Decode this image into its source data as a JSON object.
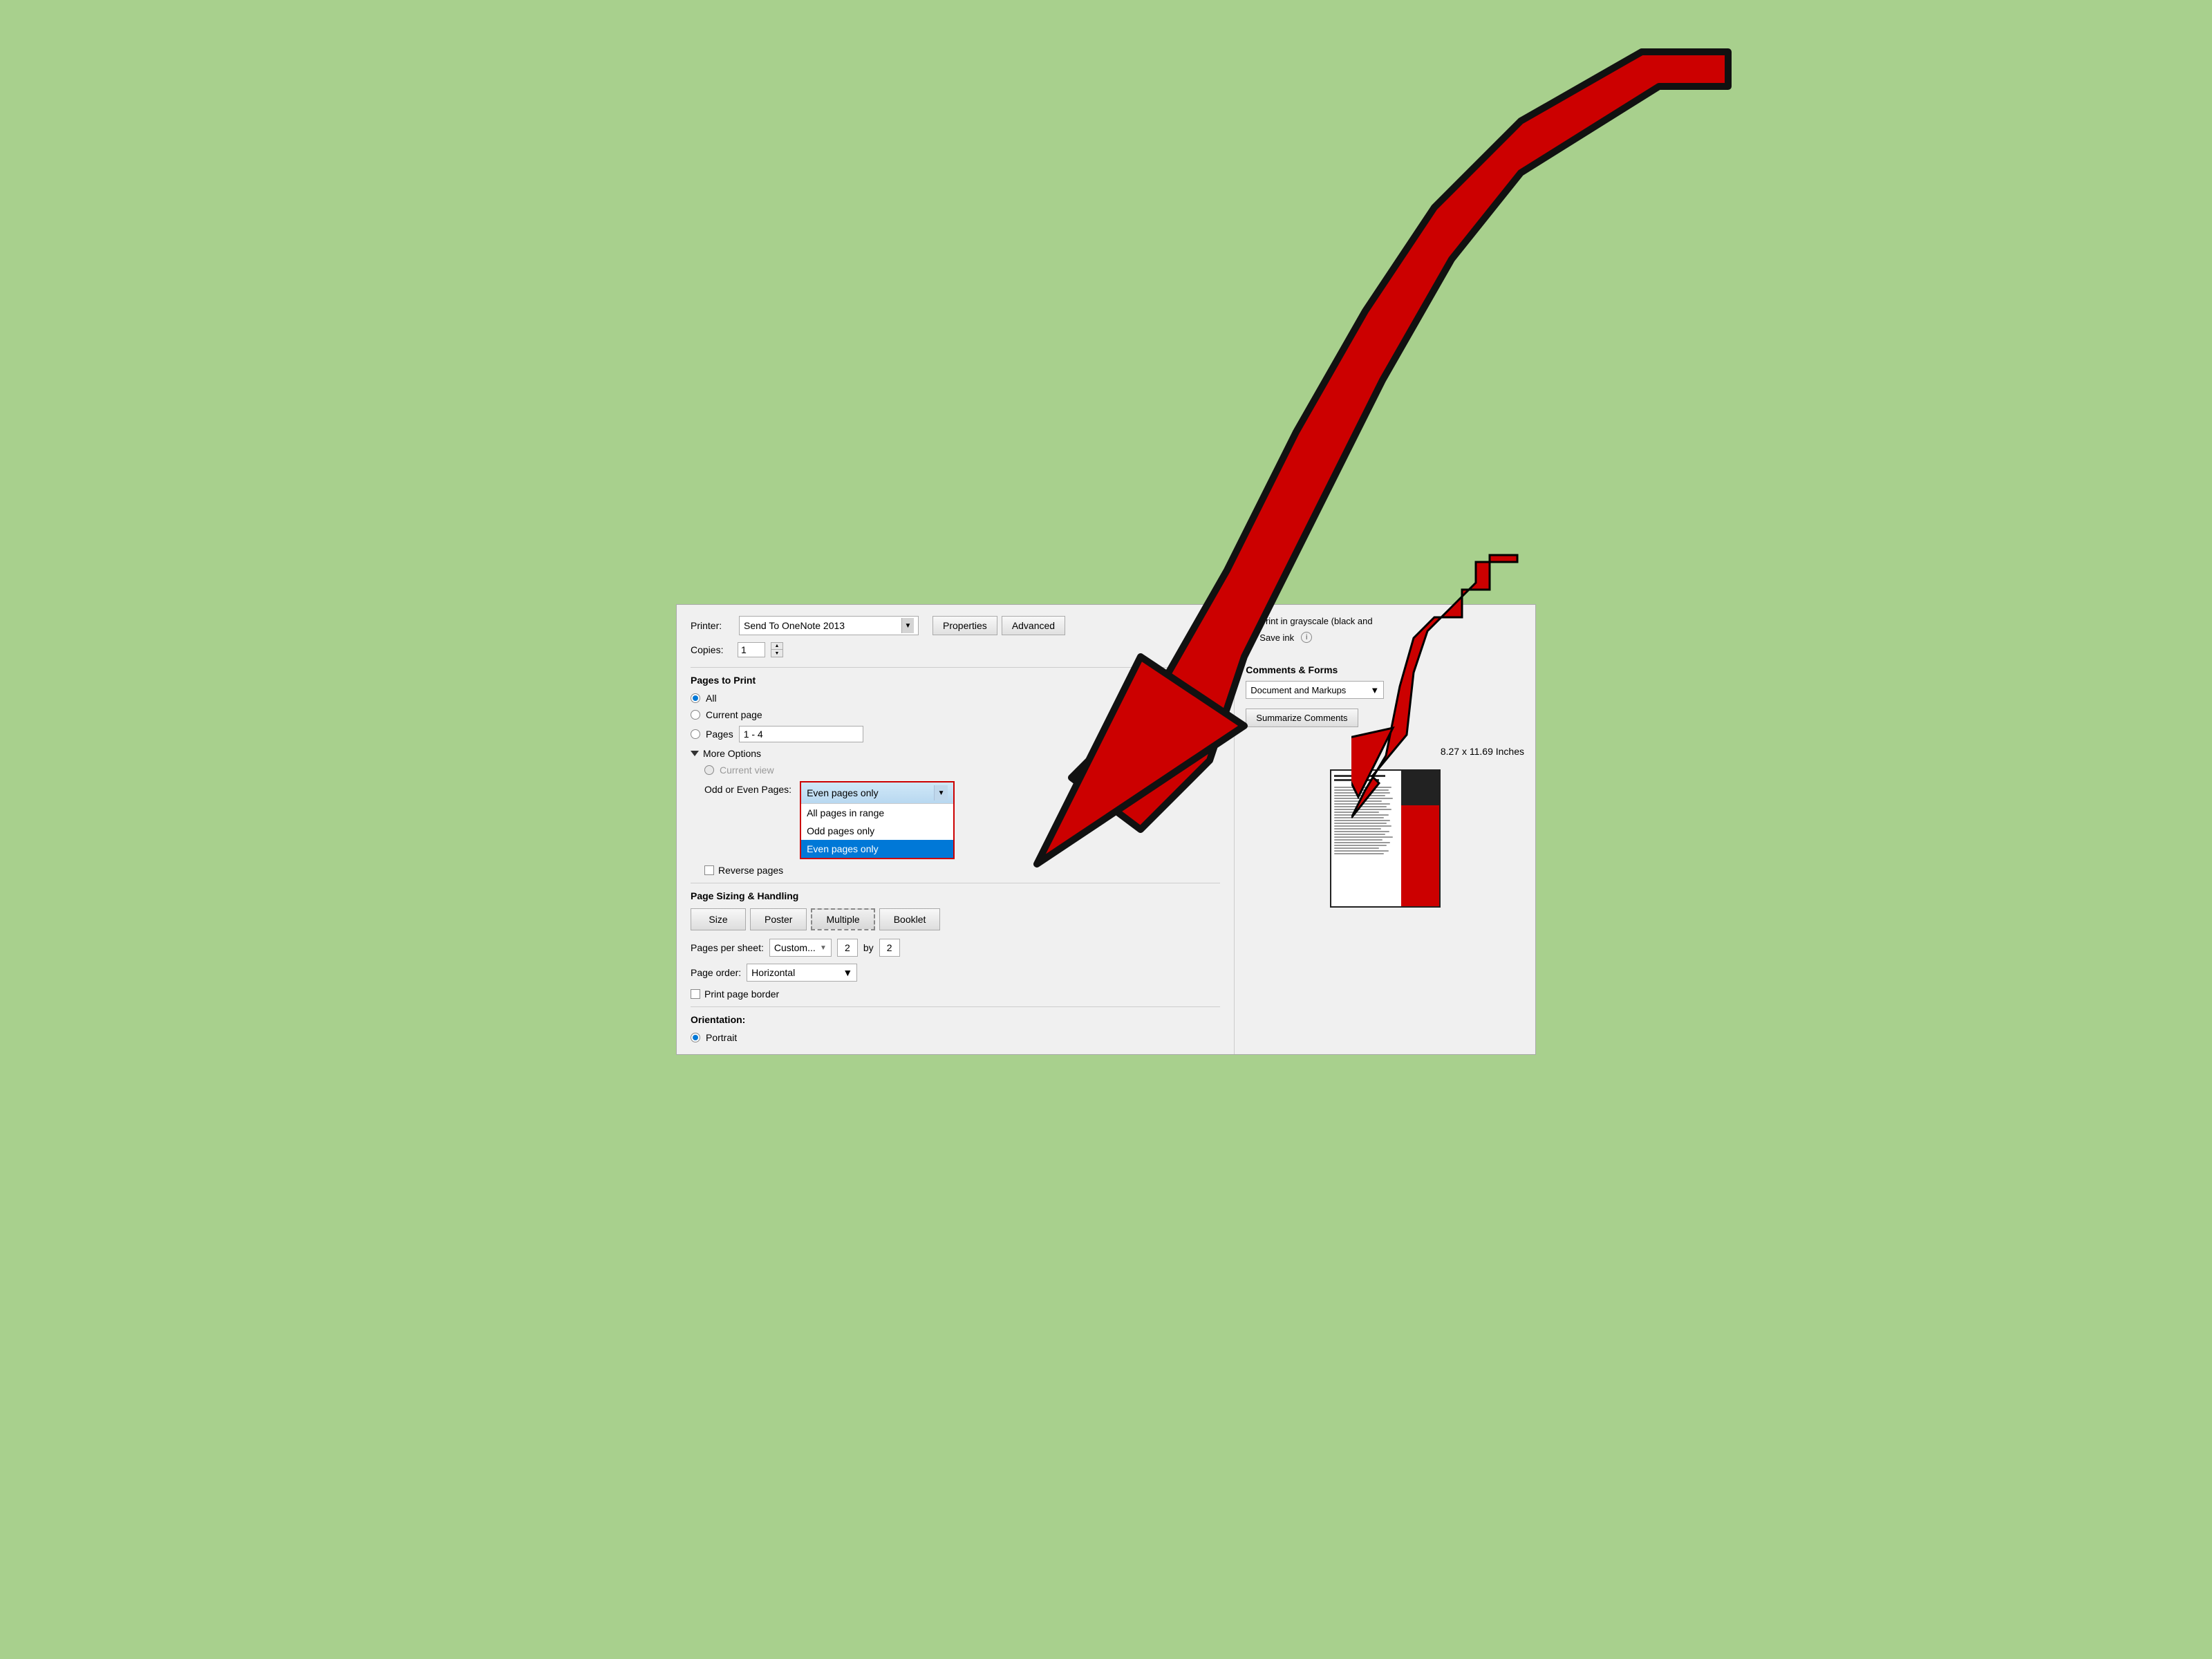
{
  "header": {
    "printer_label": "Printer:",
    "printer_value": "Send To OneNote 2013",
    "properties_btn": "Properties",
    "advanced_btn": "Advanced",
    "copies_label": "Copies:",
    "copies_value": "1"
  },
  "right_checkboxes": {
    "print_grayscale": "Print in grayscale (black and",
    "save_ink": "Save ink"
  },
  "pages_to_print": {
    "title": "Pages to Print",
    "all_label": "All",
    "current_page_label": "Current page",
    "pages_label": "Pages",
    "pages_value": "1 - 4"
  },
  "more_options": {
    "title": "More Options",
    "current_view_label": "Current view",
    "odd_even_label": "Odd or Even Pages:",
    "dropdown": {
      "selected": "Even pages only",
      "options": [
        "All pages in range",
        "Odd pages only",
        "Even pages only"
      ],
      "active_index": 2
    },
    "reverse_pages_label": "Reverse pages"
  },
  "page_sizing": {
    "title": "Page Sizing & Handling",
    "buttons": [
      "Size",
      "Poster",
      "Multiple",
      "Booklet"
    ],
    "active_index": 2
  },
  "pages_per_sheet": {
    "label": "Pages per sheet:",
    "custom_label": "Custom...",
    "value1": "2",
    "by_label": "by",
    "value2": "2"
  },
  "page_order": {
    "label": "Page order:",
    "value": "Horizontal"
  },
  "print_border": {
    "label": "Print page border"
  },
  "orientation": {
    "title": "Orientation:",
    "portrait_label": "Portrait"
  },
  "right_panel": {
    "section_title": "Comments & Forms",
    "dropdown_value": "Document and Markups",
    "button_label": "Summarize Comments",
    "dimensions": "8.27 x 11.69 Inches"
  }
}
